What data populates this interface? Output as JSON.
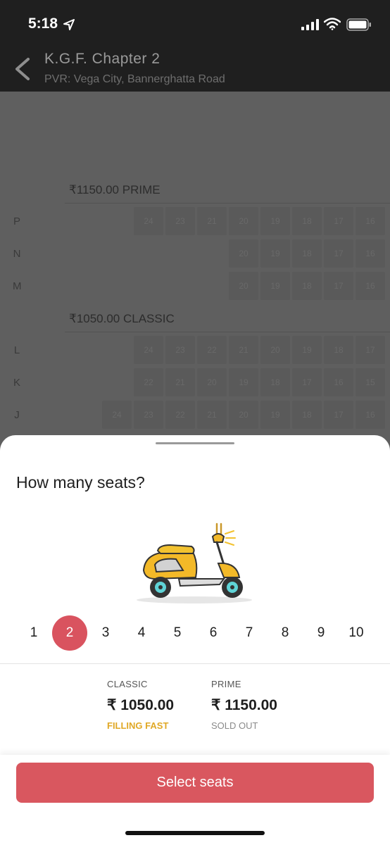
{
  "status_bar": {
    "time": "5:18"
  },
  "header": {
    "title": "K.G.F. Chapter 2",
    "venue": "PVR: Vega City, Bannerghatta Road"
  },
  "layout": {
    "sections": [
      {
        "label": "₹1150.00 PRIME",
        "rows": [
          {
            "label": "P",
            "seats": [
              "24",
              "23",
              "21",
              "20",
              "19",
              "18",
              "17",
              "16"
            ]
          },
          {
            "label": "N",
            "seats": [
              "20",
              "19",
              "18",
              "17",
              "16"
            ]
          },
          {
            "label": "M",
            "seats": [
              "20",
              "19",
              "18",
              "17",
              "16"
            ]
          }
        ]
      },
      {
        "label": "₹1050.00 CLASSIC",
        "rows": [
          {
            "label": "L",
            "seats": [
              "24",
              "23",
              "22",
              "21",
              "20",
              "19",
              "18",
              "17"
            ]
          },
          {
            "label": "K",
            "seats": [
              "22",
              "21",
              "20",
              "19",
              "18",
              "17",
              "16",
              "15"
            ]
          },
          {
            "label": "J",
            "seats": [
              "24",
              "23",
              "22",
              "21",
              "20",
              "19",
              "18",
              "17",
              "16"
            ]
          }
        ]
      }
    ]
  },
  "sheet": {
    "title": "How many seats?",
    "counts": [
      "1",
      "2",
      "3",
      "4",
      "5",
      "6",
      "7",
      "8",
      "9",
      "10"
    ],
    "selected_count": "2",
    "prices": [
      {
        "category": "CLASSIC",
        "price": "₹ 1050.00",
        "status": "FILLING FAST"
      },
      {
        "category": "PRIME",
        "price": "₹ 1150.00",
        "status": "SOLD OUT"
      }
    ],
    "select_button": "Select seats"
  },
  "colors": {
    "accent": "#d9575f",
    "filling_fast": "#e0a826",
    "sold_out": "#8a8a8a"
  }
}
